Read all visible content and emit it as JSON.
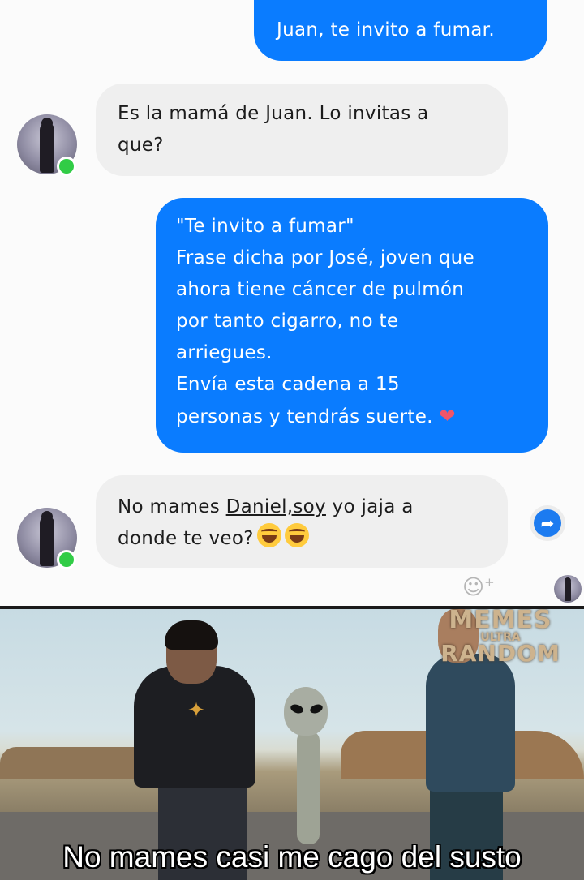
{
  "messages": [
    {
      "direction": "outgoing",
      "lines": [
        "Juan, te invito a fumar."
      ]
    },
    {
      "direction": "incoming",
      "lines": [
        "Es la mamá de Juan. Lo invitas a",
        "que?"
      ]
    },
    {
      "direction": "outgoing",
      "lines": [
        "\"Te invito a fumar\"",
        "Frase dicha por José, joven que",
        "ahora tiene cáncer de pulmón",
        "por tanto cigarro, no te",
        "arriegues.",
        "Envía esta cadena a 15",
        "personas y tendrás suerte."
      ],
      "trailing_emoji": "❤"
    },
    {
      "direction": "incoming",
      "line1_prefix": "No mames ",
      "line1_underlined": "Daniel,soy",
      "line1_suffix": " yo jaja a",
      "line2": "donde te veo?",
      "emoji_icons": [
        "laughing-face-icon",
        "laughing-face-icon"
      ]
    }
  ],
  "actions": {
    "share_icon": "share-arrow-icon",
    "react_icon": "add-reaction-icon",
    "react_plus": "+"
  },
  "meme": {
    "watermark": {
      "line1": "MEMES",
      "line2": "ULTRA",
      "line3": "RANDOM"
    },
    "caption": "No mames casi me cago del susto"
  },
  "colors": {
    "outgoing_bubble": "#0a7cff",
    "incoming_bubble": "#efefef",
    "online_dot": "#31cc46"
  }
}
